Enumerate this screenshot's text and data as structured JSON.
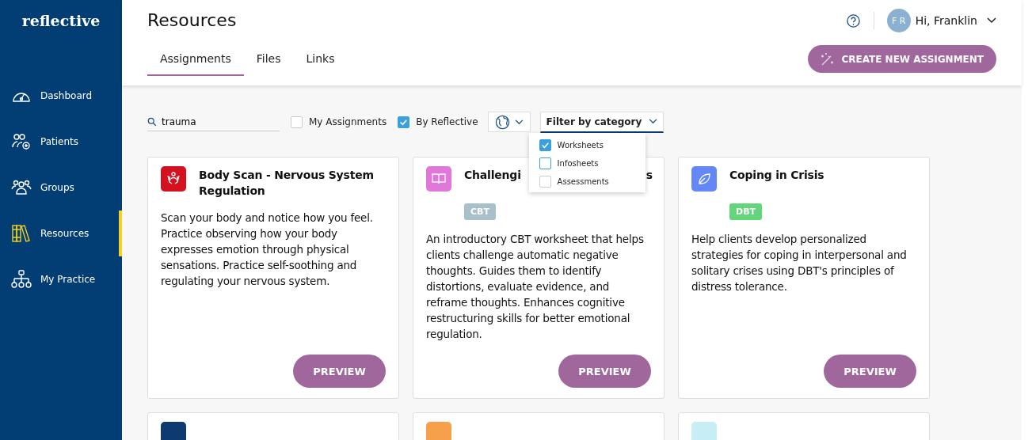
{
  "brand": "reflective",
  "nav": [
    {
      "label": "Dashboard",
      "selected": false
    },
    {
      "label": "Patients",
      "selected": false
    },
    {
      "label": "Groups",
      "selected": false
    },
    {
      "label": "Resources",
      "selected": true
    },
    {
      "label": "My Practice",
      "selected": false
    }
  ],
  "page_title": "Resources",
  "user": {
    "initials": "F R",
    "greeting": "Hi, Franklin"
  },
  "tabs": [
    {
      "label": "Assignments",
      "selected": true
    },
    {
      "label": "Files",
      "selected": false
    },
    {
      "label": "Links",
      "selected": false
    }
  ],
  "create_button": "CREATE NEW ASSIGNMENT",
  "search": {
    "value": "trauma"
  },
  "filters": [
    {
      "label": "My Assignments",
      "checked": false
    },
    {
      "label": "By Reflective",
      "checked": true
    }
  ],
  "category_filter": {
    "label": "Filter by category",
    "expanded": true,
    "options": [
      {
        "label": "Worksheets",
        "checked": true
      },
      {
        "label": "Infosheets",
        "checked": false
      },
      {
        "label": "Assessments",
        "checked": false
      }
    ]
  },
  "cards": [
    {
      "title": "Body Scan - Nervous System Regulation",
      "color": "#d3111f",
      "description": "Scan your body and notice how you feel. Practice observing how your body expresses emotion through physical sensations. Practice self-soothing and regulating your nervous system.",
      "button": "PREVIEW"
    },
    {
      "title": "Challengi",
      "title_end": "s",
      "color": "#e277da",
      "tag": {
        "label": "CBT",
        "color": "#a8c0cc"
      },
      "description": "An introductory CBT worksheet that helps clients challenge automatic negative thoughts. Guides them to identify distortions, evaluate evidence, and reframe thoughts. Enhances cognitive restructuring skills for better emotional regulation.",
      "button": "PREVIEW"
    },
    {
      "title": "Coping in Crisis",
      "color": "#6487f8",
      "tag": {
        "label": "DBT",
        "color": "#63d57b"
      },
      "description": "Help clients develop personalized strategies for coping in interpersonal and solitary crises using DBT's principles of distress tolerance.",
      "button": "PREVIEW"
    },
    {
      "color": "#0e3a72"
    },
    {
      "color": "#f7a04b"
    },
    {
      "color": "#c6eef4"
    }
  ]
}
